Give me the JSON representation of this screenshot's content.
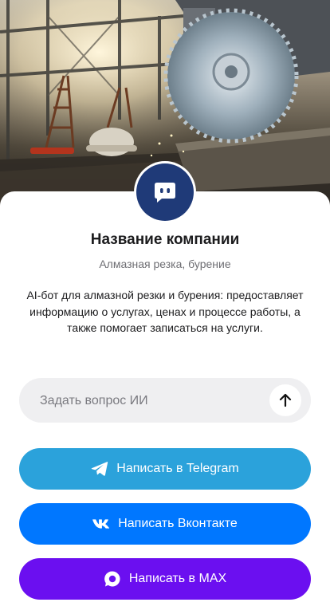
{
  "company": {
    "name": "Название компании",
    "category": "Алмазная резка, бурение",
    "description": "AI-бот для алмазной резки и бурения: предоставляет информацию о услугах, ценах и процессе работы, а также помогает записаться на услуги."
  },
  "ask": {
    "placeholder": "Задать вопрос ИИ",
    "send_icon": "arrow-up-icon"
  },
  "buttons": {
    "telegram": {
      "label": "Написать в Telegram",
      "icon": "telegram-icon",
      "color": "#2ba2db"
    },
    "vk": {
      "label": "Написать Вконтакте",
      "icon": "vk-icon",
      "color": "#0077ff"
    },
    "max": {
      "label": "Написать в MAX",
      "icon": "max-icon",
      "color": "#6b0ff0"
    }
  },
  "colors": {
    "avatar_bg": "#1f3a78",
    "card_bg": "#ffffff",
    "input_bg": "#efeff1"
  }
}
